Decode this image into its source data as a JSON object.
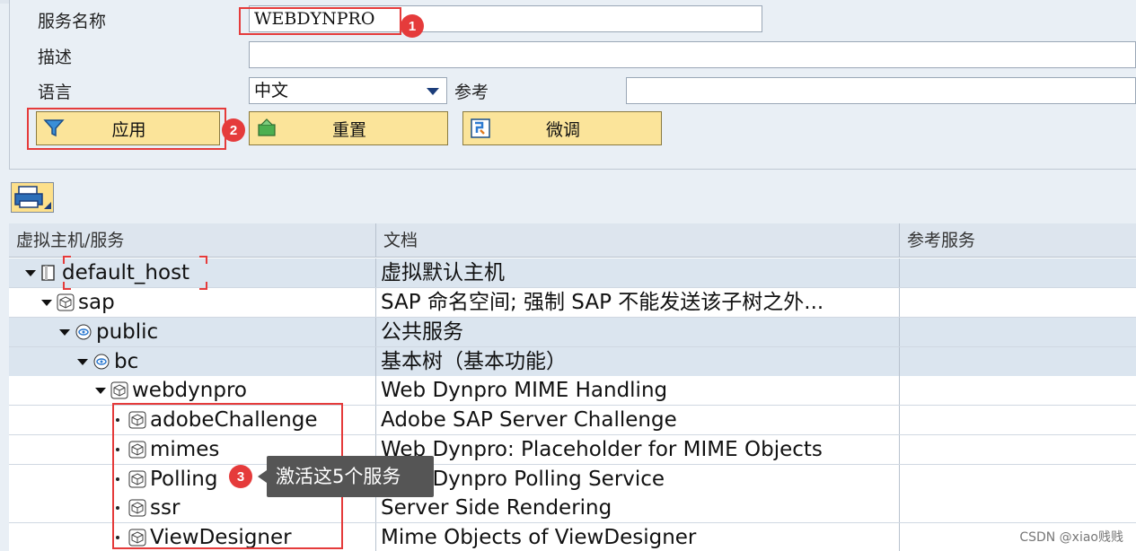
{
  "form": {
    "service_name_label": "服务名称",
    "service_name_value": "WEBDYNPRO",
    "description_label": "描述",
    "description_value": "",
    "language_label": "语言",
    "language_value": "中文",
    "reference_label": "参考",
    "reference_value": ""
  },
  "buttons": {
    "apply": "应用",
    "reset": "重置",
    "finetune": "微调"
  },
  "badges": {
    "one": "1",
    "two": "2",
    "three": "3"
  },
  "tooltip": "激活这5个服务",
  "table": {
    "headers": [
      "虚拟主机/服务",
      "文档",
      "参考服务"
    ],
    "rows": [
      {
        "name": "default_host",
        "doc": "虚拟默认主机",
        "icon": "host-icon"
      },
      {
        "name": "sap",
        "doc": "SAP 命名空间; 强制 SAP 不能发送该子树之外...",
        "icon": "service-icon"
      },
      {
        "name": "public",
        "doc": "公共服务",
        "icon": "node-icon"
      },
      {
        "name": "bc",
        "doc": "基本树（基本功能）",
        "icon": "node-icon"
      },
      {
        "name": "webdynpro",
        "doc": "Web Dynpro MIME Handling",
        "icon": "service-icon"
      },
      {
        "name": "adobeChallenge",
        "doc": "Adobe SAP Server Challenge",
        "icon": "service-icon"
      },
      {
        "name": "mimes",
        "doc": "Web Dynpro: Placeholder for MIME Objects",
        "icon": "service-icon"
      },
      {
        "name": "Polling",
        "doc": "Web Dynpro Polling Service",
        "icon": "service-icon"
      },
      {
        "name": "ssr",
        "doc": "Server Side Rendering",
        "icon": "service-icon"
      },
      {
        "name": "ViewDesigner",
        "doc": "Mime Objects of ViewDesigner",
        "icon": "service-icon"
      }
    ]
  },
  "watermark": "CSDN @xiao贱贱",
  "colors": {
    "annotation_red": "#e53b3b",
    "button_yellow": "#fbe49a",
    "row_blue": "#dbe5ef"
  }
}
